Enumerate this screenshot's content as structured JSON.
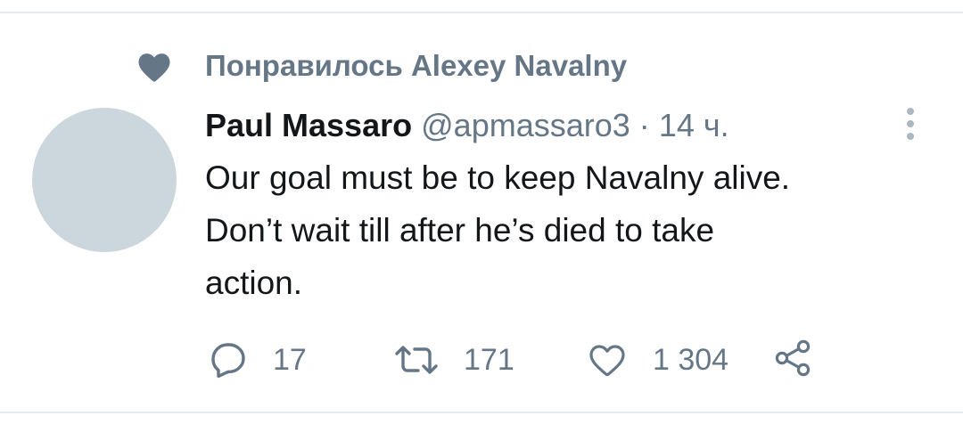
{
  "social_context": {
    "icon": "heart-filled-icon",
    "text": "Понравилось Alexey Navalny"
  },
  "tweet": {
    "author_name": "Paul Massaro",
    "handle": "@apmassaro3",
    "separator": "·",
    "time": "14 ч.",
    "text_lines": [
      "Our goal must be to keep Navalny alive.",
      "Don’t wait till after he’s died to take",
      "action."
    ]
  },
  "actions": {
    "reply_count": "17",
    "retweet_count": "171",
    "like_count": "1 304"
  },
  "colors": {
    "secondary_text": "#657786",
    "primary_text": "#14171a",
    "avatar_placeholder": "#ccd6dd",
    "divider": "#e6ecf0"
  }
}
